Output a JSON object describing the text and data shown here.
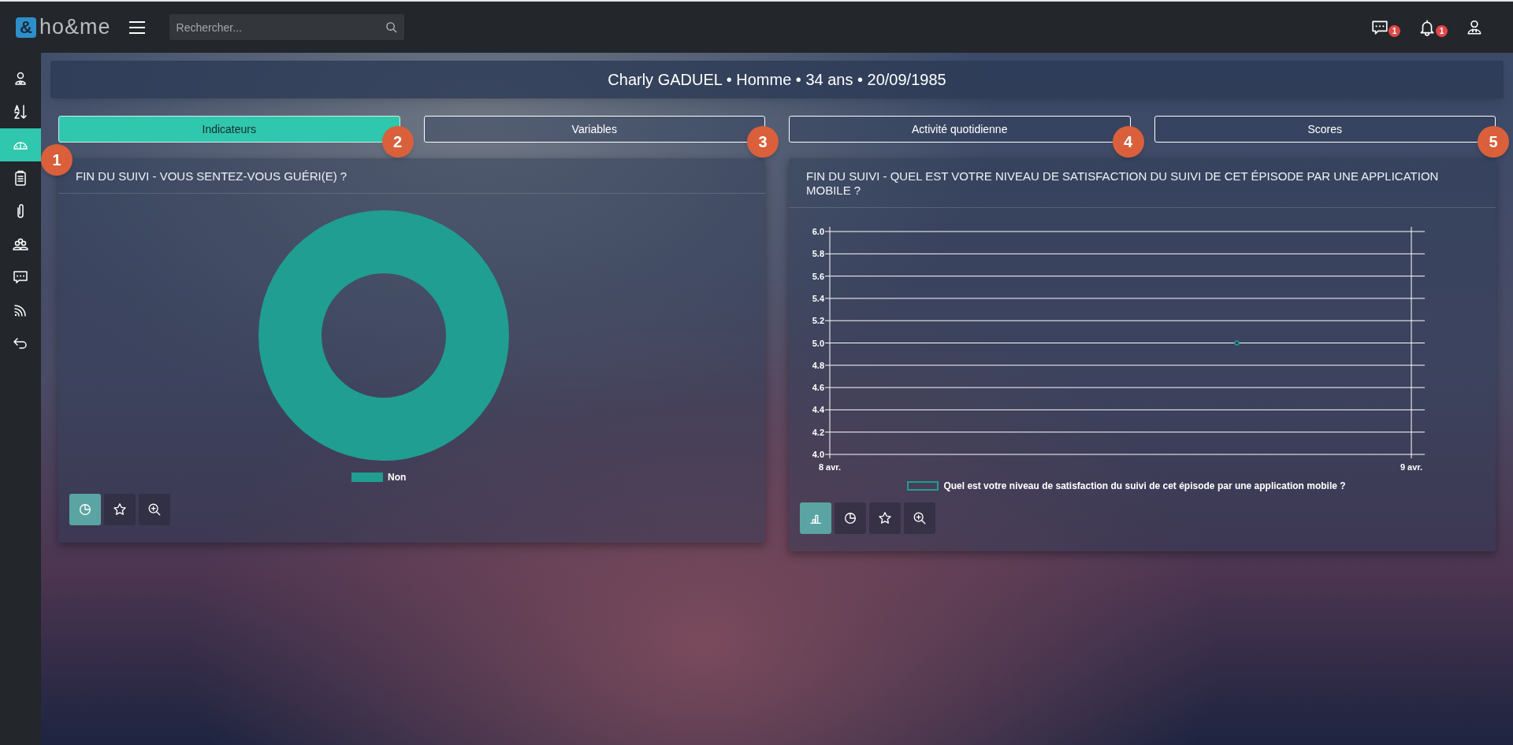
{
  "topbar": {
    "logo_mark": "&",
    "logo": "ho**&me**",
    "search": {
      "placeholder": "Rechercher..."
    },
    "notifications": [
      {
        "kind": "messages",
        "count": "1"
      },
      {
        "kind": "bell",
        "count": "1"
      },
      {
        "kind": "user"
      }
    ]
  },
  "sidebar": {
    "items": [
      {
        "kind": "profile",
        "selected": false
      },
      {
        "kind": "sort",
        "selected": false
      },
      {
        "kind": "gauge",
        "selected": true,
        "callout": "1"
      },
      {
        "kind": "clipboard",
        "selected": false
      },
      {
        "kind": "clip",
        "selected": false
      },
      {
        "kind": "group",
        "selected": false
      },
      {
        "kind": "chat",
        "selected": false
      },
      {
        "kind": "feed",
        "selected": false
      },
      {
        "kind": "back",
        "selected": false
      }
    ]
  },
  "patient_header": "Charly GADUEL • Homme • 34 ans • 20/09/1985",
  "tabs": [
    {
      "label": "Indicateurs",
      "selected": true,
      "callout": "2"
    },
    {
      "label": "Variables",
      "selected": false,
      "callout": "3"
    },
    {
      "label": "Activité quotidienne",
      "selected": false,
      "callout": "4"
    },
    {
      "label": "Scores",
      "selected": false,
      "callout": "5"
    }
  ],
  "cards": [
    {
      "title": "FIN DU SUIVI - VOUS SENTEZ-VOUS GUÉRI(E) ?",
      "chart_data": {
        "type": "pie",
        "categories": [
          "Non"
        ],
        "series": [
          {
            "color": "#209e91",
            "values": [
              100
            ]
          }
        ]
      },
      "chart_buttons": [
        {
          "kind": "pie",
          "selected": true
        },
        {
          "kind": "radar",
          "selected": false
        },
        {
          "kind": "zoom",
          "selected": false
        }
      ]
    },
    {
      "title": "FIN DU SUIVI - QUEL EST VOTRE NIVEAU DE SATISFACTION DU SUIVI DE CET ÉPISODE PAR UNE APPLICATION MOBILE ?",
      "chart_data": {
        "type": "line",
        "grid": true,
        "categories": [
          "8 avr.",
          null,
          null,
          null,
          null,
          null,
          null,
          null,
          null,
          null,
          "9 avr."
        ],
        "series": [
          {
            "name": "Quel est votre niveau de satisfaction du suivi de cet épisode par une application mobile ?",
            "color": "#209e91",
            "marker": "circle",
            "values": [
              null,
              null,
              null,
              null,
              null,
              null,
              null,
              5.0,
              null,
              null,
              null
            ]
          }
        ],
        "ylim": [
          4.0,
          6.0
        ],
        "yticks": [
          {
            "value": 4.0,
            "label": "4.0"
          },
          {
            "value": 4.2,
            "label": "4.2"
          },
          {
            "value": 4.4,
            "label": "4.4"
          },
          {
            "value": 4.6,
            "label": "4.6"
          },
          {
            "value": 4.8,
            "label": "4.8"
          },
          {
            "value": 5.0,
            "label": "5.0"
          },
          {
            "value": 5.2,
            "label": "5.2"
          },
          {
            "value": 5.4,
            "label": "5.4"
          },
          {
            "value": 5.6,
            "label": "5.6"
          },
          {
            "value": 5.8,
            "label": "5.8"
          },
          {
            "value": 6.0,
            "label": "6.0"
          }
        ]
      },
      "chart_buttons": [
        {
          "kind": "bar",
          "selected": true
        },
        {
          "kind": "pie",
          "selected": false
        },
        {
          "kind": "radar",
          "selected": false
        },
        {
          "kind": "zoom",
          "selected": false
        }
      ]
    }
  ]
}
